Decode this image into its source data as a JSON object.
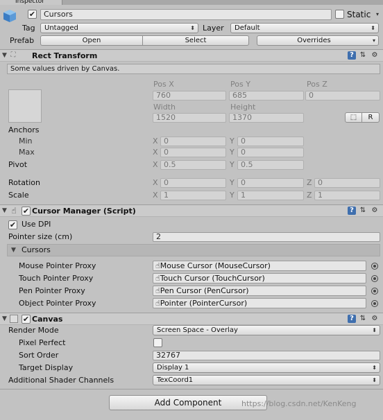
{
  "window": {
    "tab_title": "Inspector"
  },
  "object": {
    "active_checked": true,
    "name": "Cursors",
    "static_label": "Static",
    "static_checked": false,
    "tag_label": "Tag",
    "tag_value": "Untagged",
    "layer_label": "Layer",
    "layer_value": "Default",
    "prefab_label": "Prefab",
    "prefab_open": "Open",
    "prefab_select": "Select",
    "prefab_overrides": "Overrides"
  },
  "rect_transform": {
    "title": "Rect Transform",
    "driven_note": "Some values driven by Canvas.",
    "pos_x_label": "Pos X",
    "pos_x": "760",
    "pos_y_label": "Pos Y",
    "pos_y": "685",
    "pos_z_label": "Pos Z",
    "pos_z": "0",
    "width_label": "Width",
    "width": "1520",
    "height_label": "Height",
    "height": "1370",
    "r_button": "R",
    "anchors_label": "Anchors",
    "min_label": "Min",
    "min_x": "0",
    "min_y": "0",
    "max_label": "Max",
    "max_x": "0",
    "max_y": "0",
    "pivot_label": "Pivot",
    "pivot_x": "0.5",
    "pivot_y": "0.5",
    "rotation_label": "Rotation",
    "rot_x": "0",
    "rot_y": "0",
    "rot_z": "0",
    "scale_label": "Scale",
    "scale_x": "1",
    "scale_y": "1",
    "scale_z": "1",
    "x_axis": "X",
    "y_axis": "Y",
    "z_axis": "Z"
  },
  "cursor_manager": {
    "title": "Cursor Manager (Script)",
    "use_dpi_label": "Use DPI",
    "use_dpi_checked": true,
    "pointer_size_label": "Pointer size (cm)",
    "pointer_size": "2",
    "cursors_label": "Cursors",
    "proxies": [
      {
        "label": "Mouse Pointer Proxy",
        "value": "Mouse Cursor (MouseCursor)"
      },
      {
        "label": "Touch Pointer Proxy",
        "value": "Touch Cursor (TouchCursor)"
      },
      {
        "label": "Pen Pointer Proxy",
        "value": "Pen Cursor (PenCursor)"
      },
      {
        "label": "Object Pointer Proxy",
        "value": "Pointer (PointerCursor)"
      }
    ]
  },
  "canvas": {
    "title": "Canvas",
    "render_mode_label": "Render Mode",
    "render_mode": "Screen Space - Overlay",
    "pixel_perfect_label": "Pixel Perfect",
    "pixel_perfect_checked": false,
    "sort_order_label": "Sort Order",
    "sort_order": "32767",
    "target_display_label": "Target Display",
    "target_display": "Display 1",
    "shader_channels_label": "Additional Shader Channels",
    "shader_channels": "TexCoord1"
  },
  "add_component": "Add Component",
  "watermark": "https://blog.csdn.net/KenKeng",
  "icons": [
    "gameobject-cube-icon",
    "help-icon",
    "preset-icon",
    "gear-icon",
    "rect-transform-icon",
    "script-hand-icon",
    "canvas-icon",
    "hand-pointer-icon",
    "target-icon"
  ]
}
